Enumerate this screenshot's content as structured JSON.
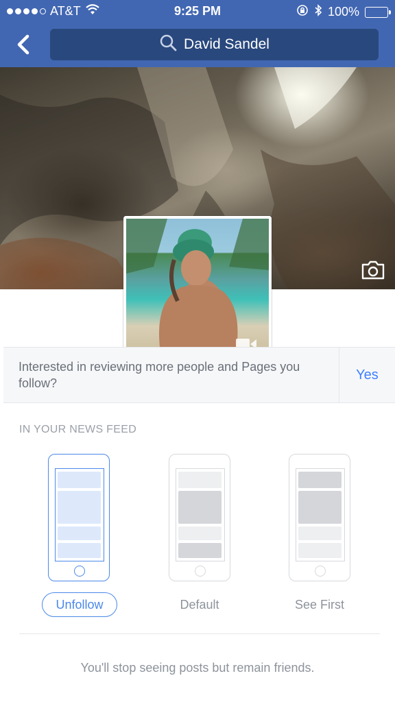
{
  "status_bar": {
    "carrier": "AT&T",
    "time": "9:25 PM",
    "battery": "100%"
  },
  "nav": {
    "search_text": "David Sandel"
  },
  "prompt": {
    "text": "Interested in reviewing more people and Pages you follow?",
    "action_label": "Yes"
  },
  "news_feed": {
    "section_label": "IN YOUR NEWS FEED",
    "options": [
      {
        "label": "Unfollow",
        "selected": true
      },
      {
        "label": "Default",
        "selected": false
      },
      {
        "label": "See First",
        "selected": false
      }
    ],
    "description": "You'll stop seeing posts but remain friends."
  },
  "colors": {
    "header_blue": "#4267b2",
    "search_blue": "#29487d",
    "accent_blue": "#4a88e8",
    "link_blue": "#4080ff"
  }
}
